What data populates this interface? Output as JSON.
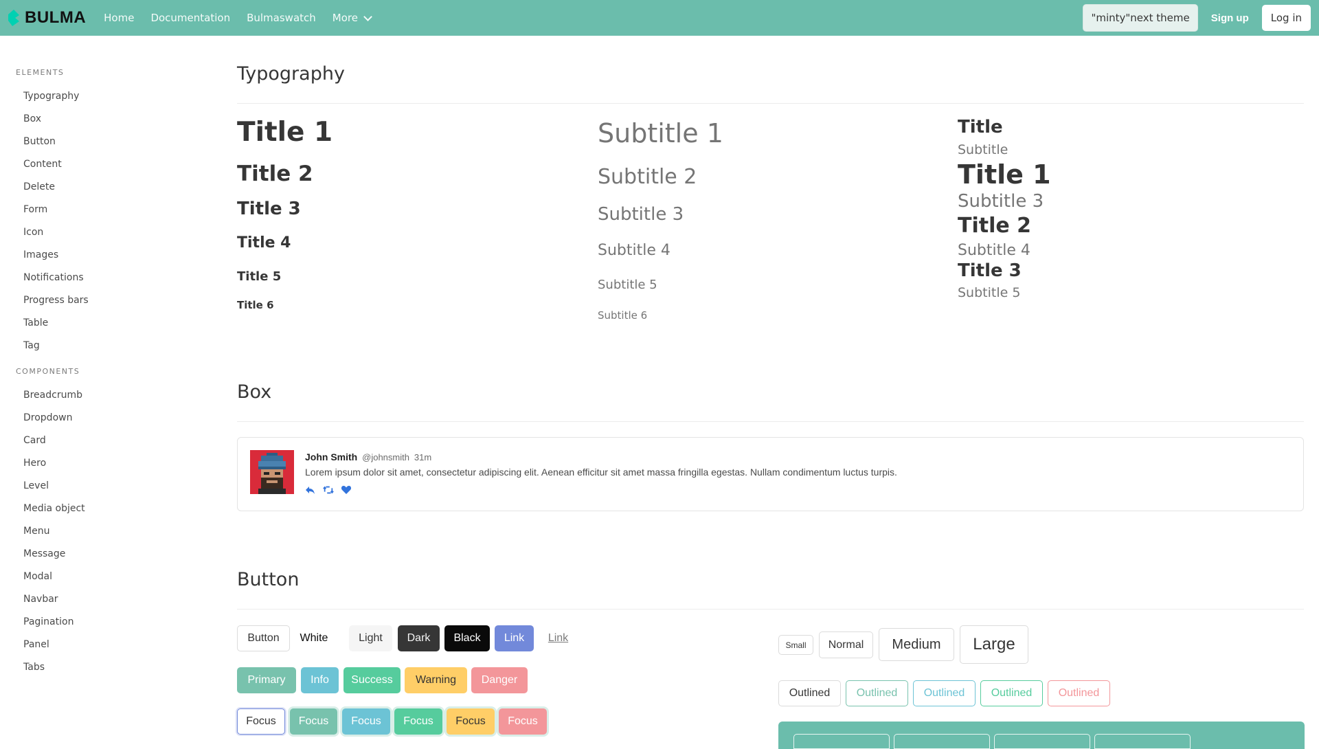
{
  "navbar": {
    "brand": "BULMA",
    "links": [
      "Home",
      "Documentation",
      "Bulmaswatch"
    ],
    "more": "More",
    "theme_button": "\"minty\"next theme",
    "signup": "Sign up",
    "login": "Log in"
  },
  "sidebar": {
    "elements_label": "ELEMENTS",
    "elements": [
      "Typography",
      "Box",
      "Button",
      "Content",
      "Delete",
      "Form",
      "Icon",
      "Images",
      "Notifications",
      "Progress bars",
      "Table",
      "Tag"
    ],
    "components_label": "COMPONENTS",
    "components": [
      "Breadcrumb",
      "Dropdown",
      "Card",
      "Hero",
      "Level",
      "Media object",
      "Menu",
      "Message",
      "Modal",
      "Navbar",
      "Pagination",
      "Panel",
      "Tabs"
    ]
  },
  "typography": {
    "heading": "Typography",
    "titles": [
      "Title 1",
      "Title 2",
      "Title 3",
      "Title 4",
      "Title 5",
      "Title 6"
    ],
    "subtitles": [
      "Subtitle 1",
      "Subtitle 2",
      "Subtitle 3",
      "Subtitle 4",
      "Subtitle 5",
      "Subtitle 6"
    ],
    "combo": {
      "title": "Title",
      "subtitle": "Subtitle",
      "title1": "Title 1",
      "subtitle3": "Subtitle 3",
      "title2": "Title 2",
      "subtitle4": "Subtitle 4",
      "title3": "Title 3",
      "subtitle5": "Subtitle 5"
    }
  },
  "box": {
    "heading": "Box",
    "name": "John Smith",
    "handle": "@johnsmith",
    "time": "31m",
    "text": "Lorem ipsum dolor sit amet, consectetur adipiscing elit. Aenean efficitur sit amet massa fringilla egestas. Nullam condimentum luctus turpis."
  },
  "button": {
    "heading": "Button",
    "row1": [
      "Button",
      "White",
      "Light",
      "Dark",
      "Black",
      "Link",
      "Link"
    ],
    "row2": [
      "Primary",
      "Info",
      "Success",
      "Warning",
      "Danger"
    ],
    "row3": [
      "Focus",
      "Focus",
      "Focus",
      "Focus",
      "Focus",
      "Focus"
    ],
    "sizes": [
      "Small",
      "Normal",
      "Medium",
      "Large"
    ],
    "outlined": [
      "Outlined",
      "Outlined",
      "Outlined",
      "Outlined",
      "Outlined"
    ]
  },
  "colors": {
    "navbar": "#6bbdac",
    "primary": "#78c2ad",
    "info": "#6cc3d5",
    "success": "#56cc9d",
    "warning": "#ffce67",
    "danger": "#f3969a",
    "link": "#7289da"
  }
}
